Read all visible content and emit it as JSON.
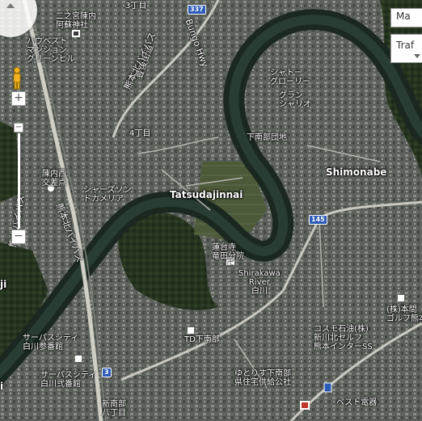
{
  "map": {
    "labels": {
      "district3": "3丁目",
      "district4": "4丁目",
      "ninomiya": "二之宮陳内\n阿蘇神社",
      "haus": "ハウベスト\nマンション\nグリーンヒル",
      "chateau": "シャトー\nグローリー",
      "grand": "グラン\nシャリオ",
      "shimonabe_complex": "下南部団地",
      "shimonabe": "Shimonabe",
      "tatsudajinnai": "Tatsudajinnai",
      "shiroyama": "シャーズソン\nドカメリア",
      "rengeji": "蓮台寺\n竜田分院",
      "shirakawa": "Shirakawa\nRiver\n白川",
      "cosmo": "コスモ石油(株)\n新川北セルフ\n熊本インターSS",
      "golf": "(株)本間\nゴルフ熊本店",
      "td": "TD下南部",
      "yume": "ゆとりす下南部\n県住宅供給公社",
      "best": "ベスト電器",
      "service1": "サーパスシティ\n白川参番館",
      "service2": "サーパスシティ\n白川弐番館",
      "shinminamibe": "新南部\n八丁目",
      "jinnai_west": "陳内西\n交差点",
      "toyo": "豊後街道",
      "hokusei": "熊本北バイパス",
      "north_bypass": "熊本北バイパス",
      "bypass_left": "熊本バイパス",
      "edge_i": "i",
      "edge_ji": "ji"
    },
    "roads": {
      "r337": "337",
      "r145": "145",
      "r3": "3",
      "bungo": "Bungo Hwy"
    },
    "controls": {
      "map_type": "Ma",
      "traffic": "Traf"
    },
    "colors": {
      "forest": "#23301f",
      "urban": "#5d625c",
      "river": "#1b2a21",
      "road": "#c9c9c0"
    }
  }
}
